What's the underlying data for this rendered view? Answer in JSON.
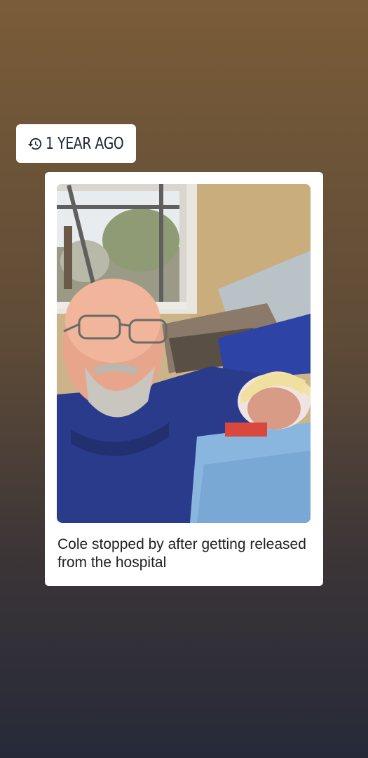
{
  "memory": {
    "time_label": "1 YEAR AGO",
    "time_icon": "history-icon",
    "caption": "Cole stopped by after getting released from the hospital"
  },
  "colors": {
    "card_background": "#ffffff",
    "badge_text": "#1c2433",
    "caption_text": "#1f1f1f"
  }
}
